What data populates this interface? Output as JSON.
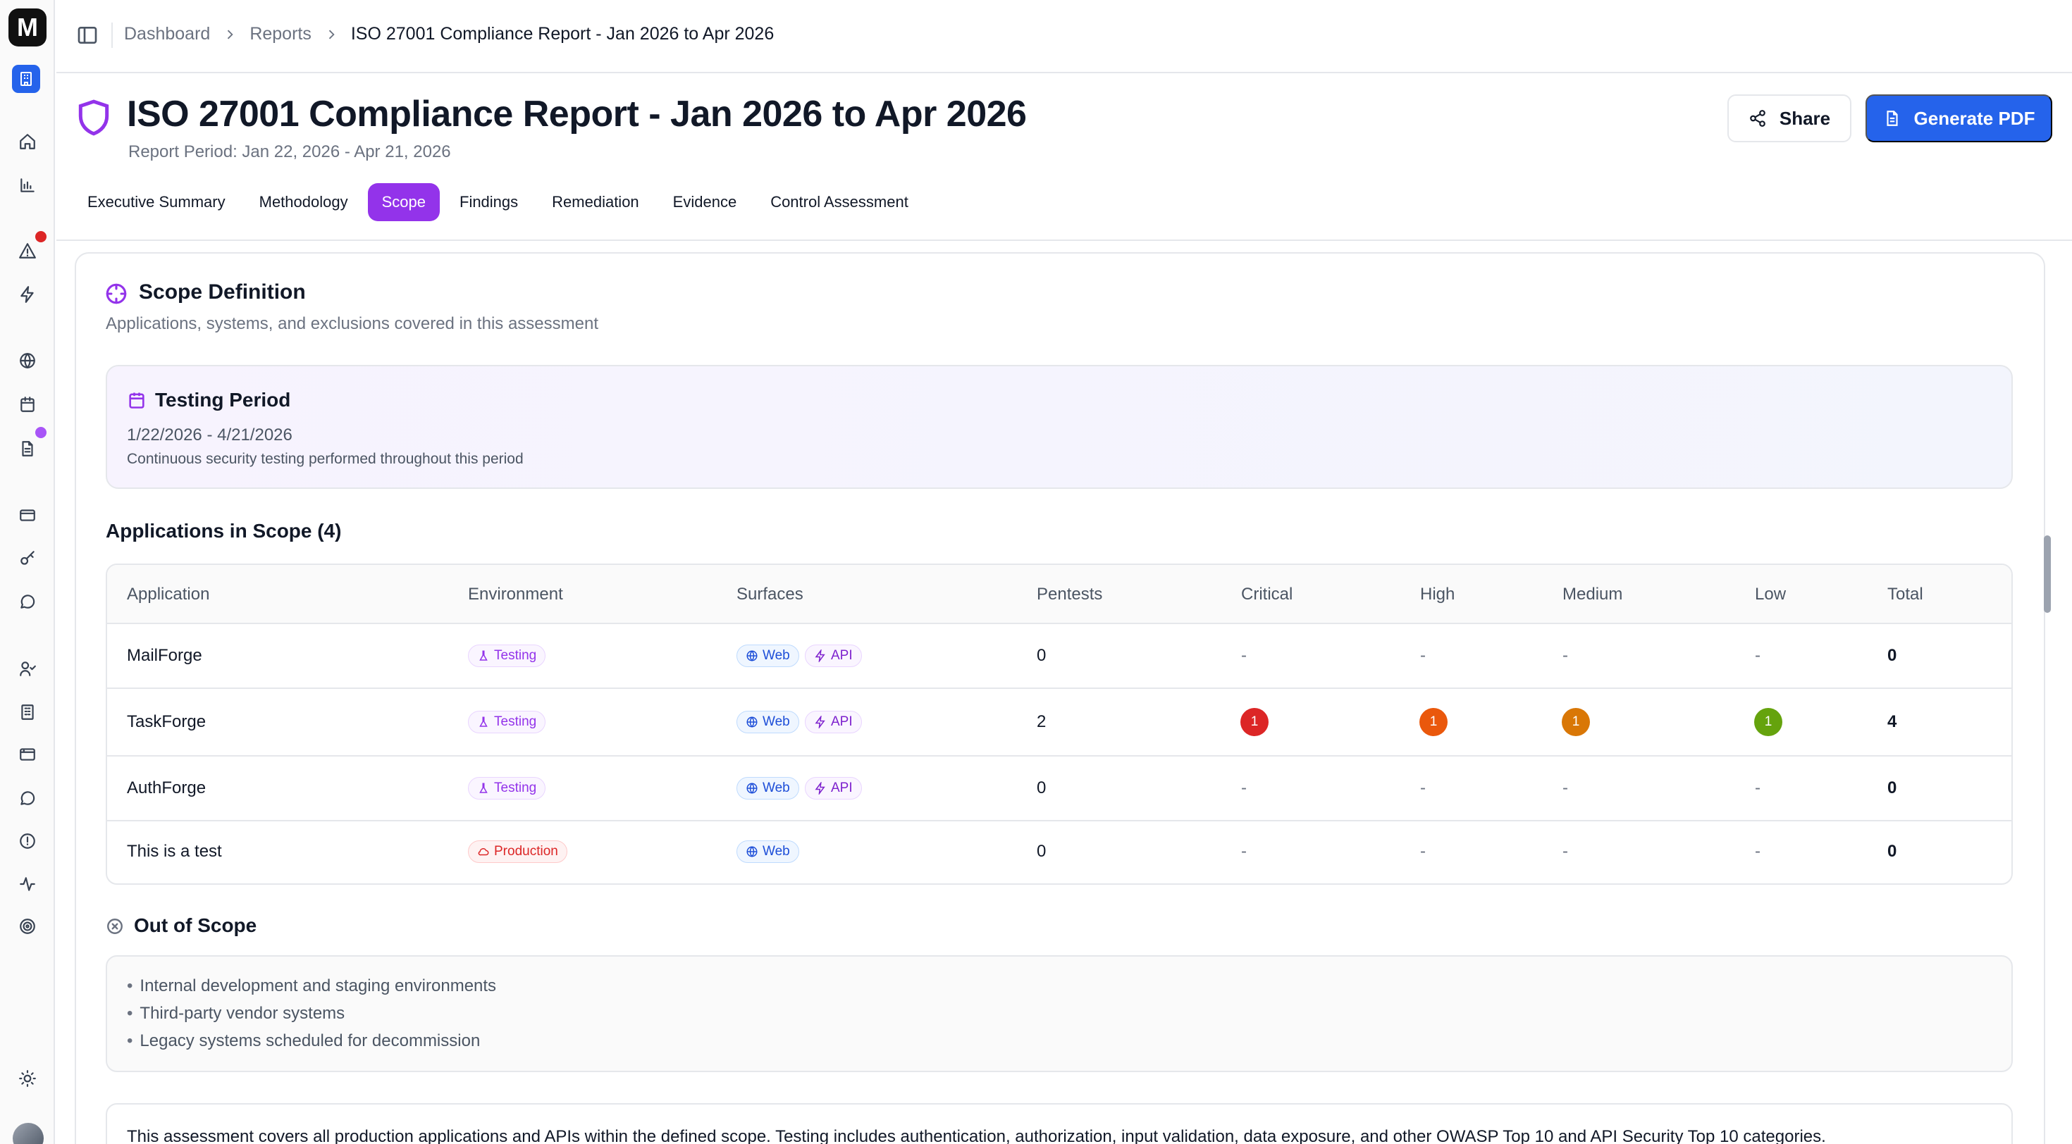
{
  "breadcrumb": {
    "items": [
      "Dashboard",
      "Reports"
    ],
    "current": "ISO 27001 Compliance Report - Jan 2026 to Apr 2026"
  },
  "header": {
    "title": "ISO 27001 Compliance Report - Jan 2026 to Apr 2026",
    "period": "Report Period: Jan 22, 2026 - Apr 21, 2026",
    "share_label": "Share",
    "pdf_label": "Generate PDF"
  },
  "sidebar": {
    "logo": "M",
    "icons": [
      "home-icon",
      "chart-icon",
      "alert-triangle-icon",
      "zap-icon",
      "globe-icon",
      "calendar-icon",
      "file-text-icon",
      "credit-card-icon",
      "key-icon",
      "message-icon",
      "user-check-icon",
      "building-icon",
      "browser-icon",
      "chat-icon",
      "alert-circle-icon",
      "activity-icon",
      "target-icon",
      "sun-icon"
    ],
    "badges": {
      "alerts": "#dc2626",
      "reports": "#a855f7"
    }
  },
  "tabs": [
    {
      "label": "Executive Summary",
      "active": false
    },
    {
      "label": "Methodology",
      "active": false
    },
    {
      "label": "Scope",
      "active": true
    },
    {
      "label": "Findings",
      "active": false
    },
    {
      "label": "Remediation",
      "active": false
    },
    {
      "label": "Evidence",
      "active": false
    },
    {
      "label": "Control Assessment",
      "active": false
    }
  ],
  "scope": {
    "title": "Scope Definition",
    "description": "Applications, systems, and exclusions covered in this assessment",
    "testing_period": {
      "title": "Testing Period",
      "range": "1/22/2026 - 4/21/2026",
      "note": "Continuous security testing performed throughout this period"
    },
    "apps_title": "Applications in Scope (4)",
    "columns": [
      "Application",
      "Environment",
      "Surfaces",
      "Pentests",
      "Critical",
      "High",
      "Medium",
      "Low",
      "Total"
    ],
    "rows": [
      {
        "app": "MailForge",
        "env": "Testing",
        "surfaces": [
          "Web",
          "API"
        ],
        "pentests": "0",
        "critical": "-",
        "high": "-",
        "medium": "-",
        "low": "-",
        "total": "0"
      },
      {
        "app": "TaskForge",
        "env": "Testing",
        "surfaces": [
          "Web",
          "API"
        ],
        "pentests": "2",
        "critical": "1",
        "high": "1",
        "medium": "1",
        "low": "1",
        "total": "4"
      },
      {
        "app": "AuthForge",
        "env": "Testing",
        "surfaces": [
          "Web",
          "API"
        ],
        "pentests": "0",
        "critical": "-",
        "high": "-",
        "medium": "-",
        "low": "-",
        "total": "0"
      },
      {
        "app": "This is a test",
        "env": "Production",
        "surfaces": [
          "Web"
        ],
        "pentests": "0",
        "critical": "-",
        "high": "-",
        "medium": "-",
        "low": "-",
        "total": "0"
      }
    ],
    "severity_colors": {
      "critical": "#dc2626",
      "high": "#ea580c",
      "medium": "#d97706",
      "low": "#65a30d"
    },
    "out_of_scope_title": "Out of Scope",
    "out_of_scope": [
      "Internal development and staging environments",
      "Third-party vendor systems",
      "Legacy systems scheduled for decommission"
    ],
    "summary": "This assessment covers all production applications and APIs within the defined scope. Testing includes authentication, authorization, input validation, data exposure, and other OWASP Top 10 and API Security Top 10 categories."
  },
  "colors": {
    "accent": "#9333ea",
    "primary": "#2563eb"
  }
}
